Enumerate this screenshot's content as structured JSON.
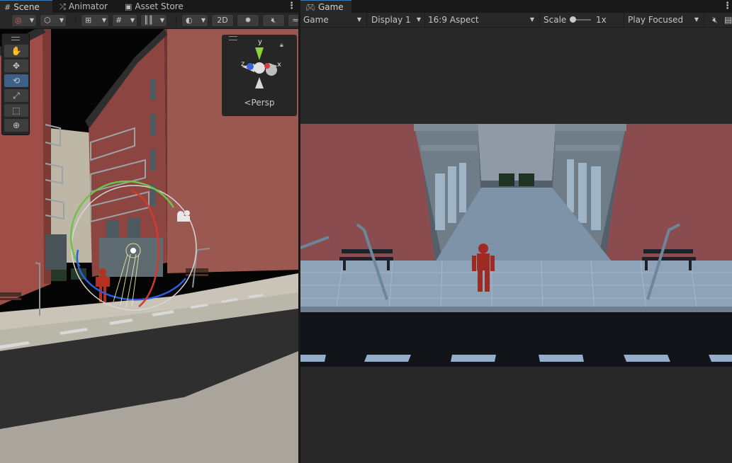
{
  "scene_panel": {
    "tabs": [
      {
        "label": "Scene",
        "icon": "hash-grid-icon",
        "active": true
      },
      {
        "label": "Animator",
        "icon": "animator-icon",
        "active": false
      },
      {
        "label": "Asset Store",
        "icon": "store-bag-icon",
        "active": false
      }
    ],
    "toolbar": {
      "mode_2d_label": "2D"
    },
    "tools": [
      {
        "name": "hand-tool",
        "glyph": "✋"
      },
      {
        "name": "move-tool",
        "glyph": "✥"
      },
      {
        "name": "rotate-tool",
        "glyph": "⟲",
        "selected": true
      },
      {
        "name": "scale-tool",
        "glyph": "⤢"
      },
      {
        "name": "rect-tool",
        "glyph": "⬚"
      },
      {
        "name": "transform-tool",
        "glyph": "⊕"
      }
    ],
    "gizmo": {
      "y_label": "y",
      "x_label": "x",
      "z_label": "z",
      "projection_label": "Persp"
    }
  },
  "game_panel": {
    "tab": {
      "label": "Game",
      "icon": "gamepad-icon"
    },
    "toolbar": {
      "view_mode": "Game",
      "display": "Display 1",
      "aspect": "16:9 Aspect",
      "scale_label": "Scale",
      "scale_value": "1x",
      "play_mode": "Play Focused"
    }
  },
  "colors": {
    "editor_bg": "#282828",
    "tab_bar_bg": "#191919",
    "selected_tool": "#3e5f86",
    "active_tab_accent": "#3a79bb",
    "gizmo_y": "#8fd13a",
    "gizmo_x": "#d83b3b",
    "gizmo_z": "#3a66d8"
  }
}
